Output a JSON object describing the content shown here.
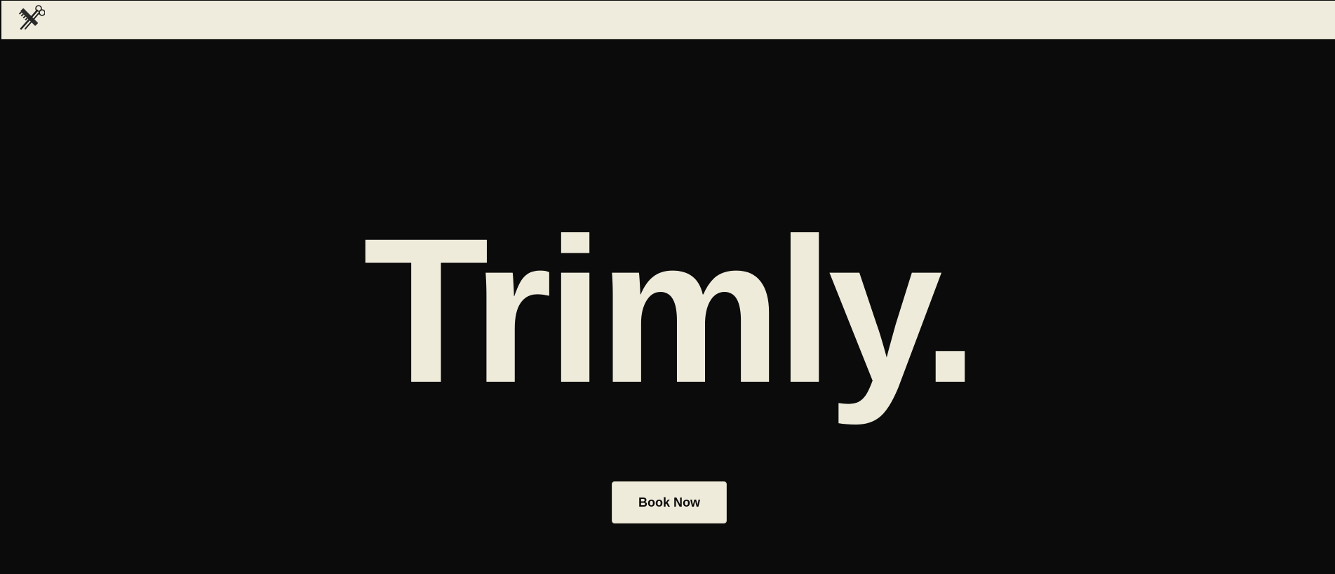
{
  "header": {
    "logo_icon": "scissors-comb-icon"
  },
  "hero": {
    "title": "Trimly.",
    "book_button_label": "Book Now"
  },
  "colors": {
    "background": "#0b0b0b",
    "cream": "#eeebdb",
    "header_bg": "#efecdd"
  }
}
